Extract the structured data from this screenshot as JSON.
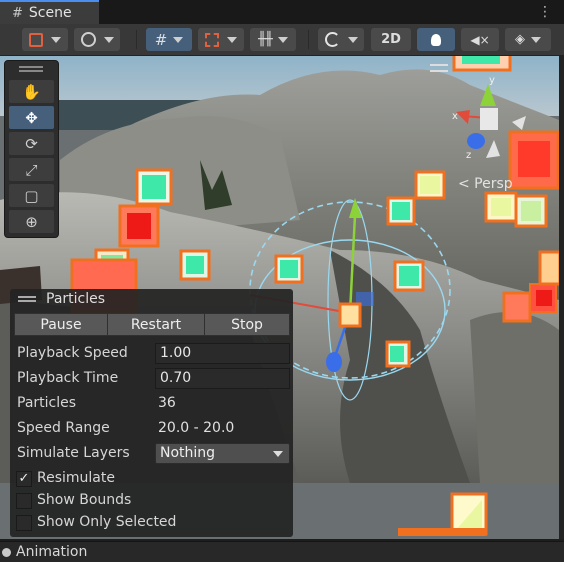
{
  "tab": {
    "icon": "hash-icon",
    "title": "Scene",
    "menu_glyph": "⋮"
  },
  "toolbar": {
    "two_d_label": "2D",
    "buttons": [
      "orientation-tool-icon",
      "global-icon",
      "grid-snap-icon",
      "snap-increment-icon",
      "ruler-icon",
      "shading-mode-icon",
      "light-icon",
      "audio-icon",
      "effects-icon",
      "gizmos-icon"
    ]
  },
  "tools": [
    "hand-icon",
    "move-icon",
    "rotate-icon",
    "scale-icon",
    "rect-icon",
    "transform-icon"
  ],
  "tool_glyphs": {
    "hand": "✋",
    "move": "✥",
    "rotate": "⟳",
    "scale": "⤢",
    "rect": "▢",
    "transform": "⊕"
  },
  "gizmo": {
    "view_label": "< Persp",
    "axes": {
      "x": "x",
      "y": "y",
      "z": "z"
    }
  },
  "particles_panel": {
    "title": "Particles",
    "buttons": {
      "pause": "Pause",
      "restart": "Restart",
      "stop": "Stop"
    },
    "playback_speed": {
      "label": "Playback Speed",
      "value": "1.00"
    },
    "playback_time": {
      "label": "Playback Time",
      "value": "0.70"
    },
    "particles": {
      "label": "Particles",
      "value": "36"
    },
    "speed_range": {
      "label": "Speed Range",
      "value": "20.0 - 20.0"
    },
    "simulate_layers": {
      "label": "Simulate Layers",
      "value": "Nothing"
    },
    "resimulate": {
      "label": "Resimulate",
      "checked": true,
      "mark": "✓"
    },
    "show_bounds": {
      "label": "Show Bounds",
      "checked": false
    },
    "show_only_selected": {
      "label": "Show Only Selected",
      "checked": false
    }
  },
  "bottom_panel": {
    "title": "Animation"
  },
  "colors": {
    "accent": "#4c8df0",
    "selection_orange": "#f07020",
    "particle_teal": "#3ee8a8",
    "particle_red": "#ff3a2a",
    "particle_lime": "#e9f7a0"
  }
}
